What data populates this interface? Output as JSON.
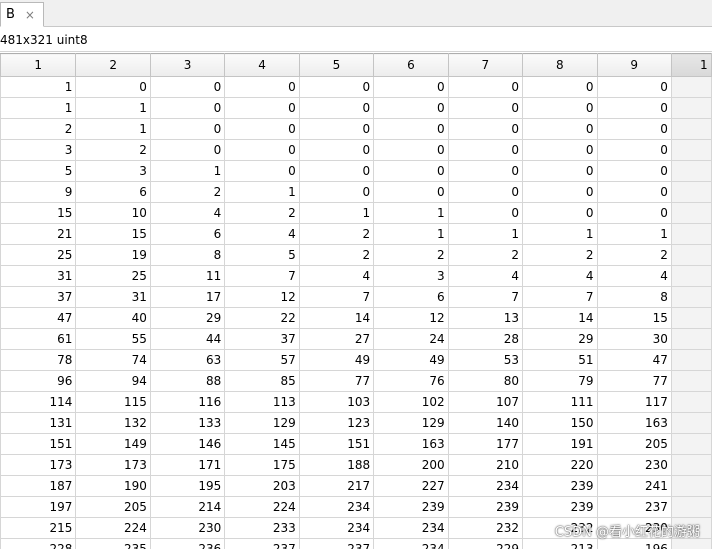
{
  "tab": {
    "label": "B",
    "close_glyph": "×"
  },
  "info": {
    "text": "481x321 uint8"
  },
  "columns": [
    "1",
    "2",
    "3",
    "4",
    "5",
    "6",
    "7",
    "8",
    "9",
    "1"
  ],
  "rows": [
    [
      "1",
      "0",
      "0",
      "0",
      "0",
      "0",
      "0",
      "0",
      "0",
      ""
    ],
    [
      "1",
      "1",
      "0",
      "0",
      "0",
      "0",
      "0",
      "0",
      "0",
      ""
    ],
    [
      "2",
      "1",
      "0",
      "0",
      "0",
      "0",
      "0",
      "0",
      "0",
      ""
    ],
    [
      "3",
      "2",
      "0",
      "0",
      "0",
      "0",
      "0",
      "0",
      "0",
      ""
    ],
    [
      "5",
      "3",
      "1",
      "0",
      "0",
      "0",
      "0",
      "0",
      "0",
      ""
    ],
    [
      "9",
      "6",
      "2",
      "1",
      "0",
      "0",
      "0",
      "0",
      "0",
      ""
    ],
    [
      "15",
      "10",
      "4",
      "2",
      "1",
      "1",
      "0",
      "0",
      "0",
      ""
    ],
    [
      "21",
      "15",
      "6",
      "4",
      "2",
      "1",
      "1",
      "1",
      "1",
      ""
    ],
    [
      "25",
      "19",
      "8",
      "5",
      "2",
      "2",
      "2",
      "2",
      "2",
      ""
    ],
    [
      "31",
      "25",
      "11",
      "7",
      "4",
      "3",
      "4",
      "4",
      "4",
      ""
    ],
    [
      "37",
      "31",
      "17",
      "12",
      "7",
      "6",
      "7",
      "7",
      "8",
      ""
    ],
    [
      "47",
      "40",
      "29",
      "22",
      "14",
      "12",
      "13",
      "14",
      "15",
      ""
    ],
    [
      "61",
      "55",
      "44",
      "37",
      "27",
      "24",
      "28",
      "29",
      "30",
      ""
    ],
    [
      "78",
      "74",
      "63",
      "57",
      "49",
      "49",
      "53",
      "51",
      "47",
      ""
    ],
    [
      "96",
      "94",
      "88",
      "85",
      "77",
      "76",
      "80",
      "79",
      "77",
      ""
    ],
    [
      "114",
      "115",
      "116",
      "113",
      "103",
      "102",
      "107",
      "111",
      "117",
      ""
    ],
    [
      "131",
      "132",
      "133",
      "129",
      "123",
      "129",
      "140",
      "150",
      "163",
      ""
    ],
    [
      "151",
      "149",
      "146",
      "145",
      "151",
      "163",
      "177",
      "191",
      "205",
      ""
    ],
    [
      "173",
      "173",
      "171",
      "175",
      "188",
      "200",
      "210",
      "220",
      "230",
      ""
    ],
    [
      "187",
      "190",
      "195",
      "203",
      "217",
      "227",
      "234",
      "239",
      "241",
      ""
    ],
    [
      "197",
      "205",
      "214",
      "224",
      "234",
      "239",
      "239",
      "239",
      "237",
      ""
    ],
    [
      "215",
      "224",
      "230",
      "233",
      "234",
      "234",
      "232",
      "232",
      "230",
      ""
    ],
    [
      "228",
      "235",
      "236",
      "237",
      "237",
      "234",
      "229",
      "213",
      "196",
      ""
    ]
  ],
  "watermark": "CSDN @看小红花的游粥"
}
